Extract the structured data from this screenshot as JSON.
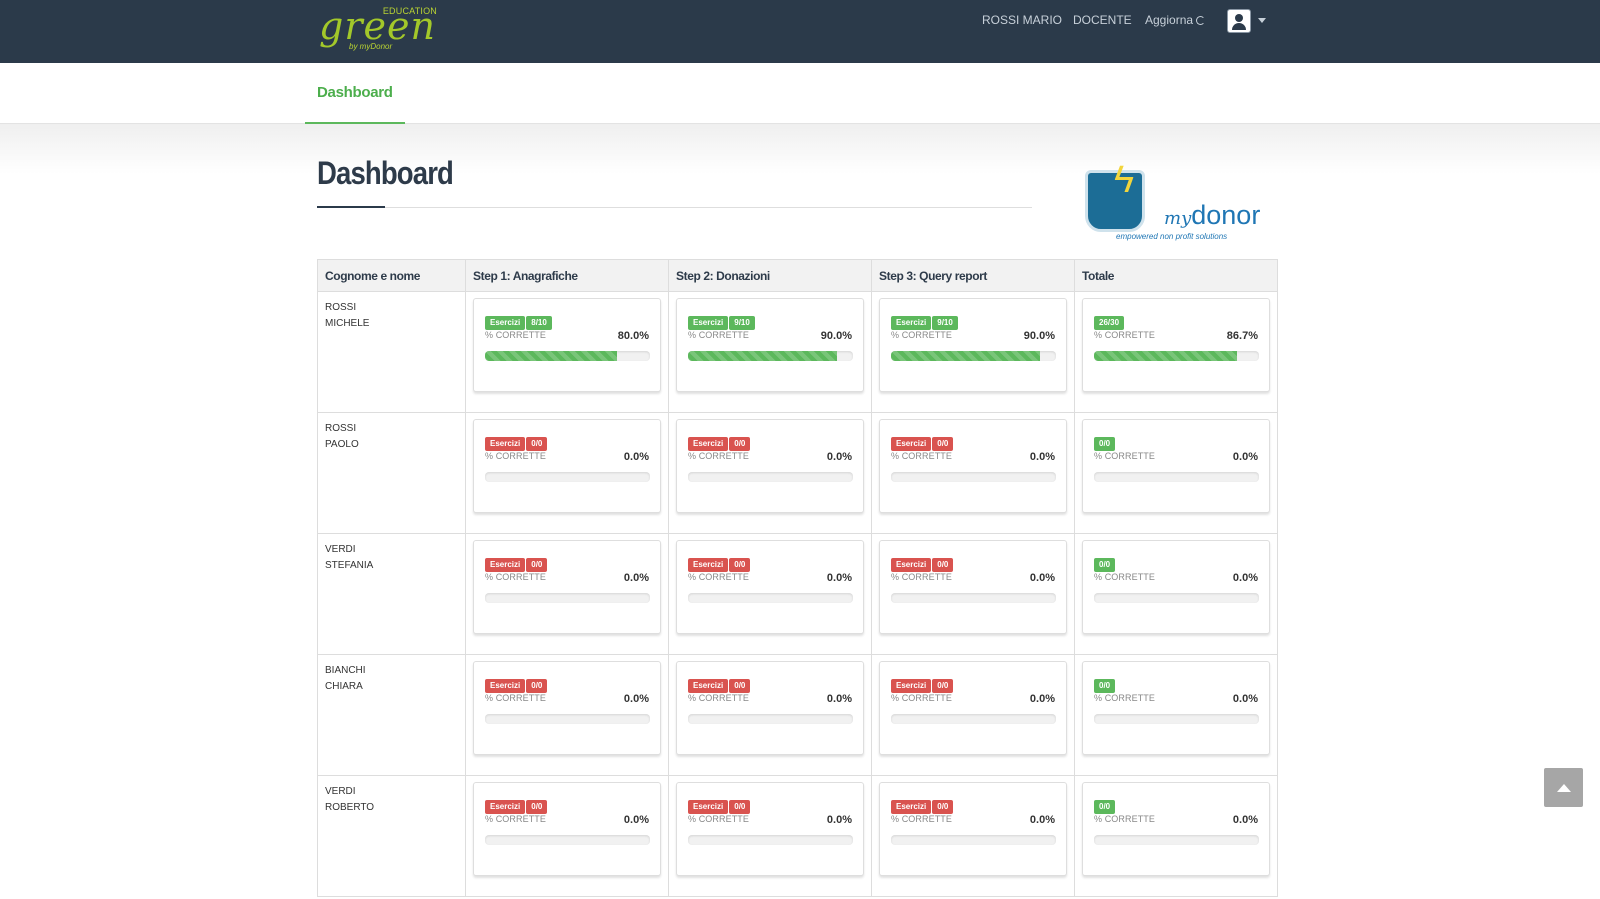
{
  "header": {
    "brand_top": "EDUCATION",
    "brand_main": "green",
    "brand_sub": "by myDonor",
    "user_name": "ROSSI MARIO",
    "role": "DOCENTE",
    "refresh_label": "Aggiorna"
  },
  "subnav": {
    "tab_label": "Dashboard"
  },
  "page": {
    "title": "Dashboard"
  },
  "partner_logo": {
    "prefix": "my",
    "name": "donor",
    "tagline": "empowered non profit solutions"
  },
  "table": {
    "columns": [
      "Cognome e nome",
      "Step 1: Anagrafiche",
      "Step 2: Donazioni",
      "Step 3: Query report",
      "Totale"
    ],
    "pct_label": "% CORRETTE",
    "exercise_label": "Esercizi",
    "rows": [
      {
        "surname": "ROSSI",
        "firstname": "MICHELE",
        "cells": [
          {
            "score": "8/10",
            "pct": "80.0%",
            "fill": 0.8,
            "status": "green"
          },
          {
            "score": "9/10",
            "pct": "90.0%",
            "fill": 0.9,
            "status": "green"
          },
          {
            "score": "9/10",
            "pct": "90.0%",
            "fill": 0.9,
            "status": "green"
          },
          {
            "score": "26/30",
            "pct": "86.7%",
            "fill": 0.867,
            "status": "green"
          }
        ]
      },
      {
        "surname": "ROSSI",
        "firstname": "PAOLO",
        "cells": [
          {
            "score": "0/0",
            "pct": "0.0%",
            "fill": 0,
            "status": "red"
          },
          {
            "score": "0/0",
            "pct": "0.0%",
            "fill": 0,
            "status": "red"
          },
          {
            "score": "0/0",
            "pct": "0.0%",
            "fill": 0,
            "status": "red"
          },
          {
            "score": "0/0",
            "pct": "0.0%",
            "fill": 0,
            "status": "green"
          }
        ]
      },
      {
        "surname": "VERDI",
        "firstname": "STEFANIA",
        "cells": [
          {
            "score": "0/0",
            "pct": "0.0%",
            "fill": 0,
            "status": "red"
          },
          {
            "score": "0/0",
            "pct": "0.0%",
            "fill": 0,
            "status": "red"
          },
          {
            "score": "0/0",
            "pct": "0.0%",
            "fill": 0,
            "status": "red"
          },
          {
            "score": "0/0",
            "pct": "0.0%",
            "fill": 0,
            "status": "green"
          }
        ]
      },
      {
        "surname": "BIANCHI",
        "firstname": "CHIARA",
        "cells": [
          {
            "score": "0/0",
            "pct": "0.0%",
            "fill": 0,
            "status": "red"
          },
          {
            "score": "0/0",
            "pct": "0.0%",
            "fill": 0,
            "status": "red"
          },
          {
            "score": "0/0",
            "pct": "0.0%",
            "fill": 0,
            "status": "red"
          },
          {
            "score": "0/0",
            "pct": "0.0%",
            "fill": 0,
            "status": "green"
          }
        ]
      },
      {
        "surname": "VERDI",
        "firstname": "ROBERTO",
        "cells": [
          {
            "score": "0/0",
            "pct": "0.0%",
            "fill": 0,
            "status": "red"
          },
          {
            "score": "0/0",
            "pct": "0.0%",
            "fill": 0,
            "status": "red"
          },
          {
            "score": "0/0",
            "pct": "0.0%",
            "fill": 0,
            "status": "red"
          },
          {
            "score": "0/0",
            "pct": "0.0%",
            "fill": 0,
            "status": "green"
          }
        ]
      }
    ]
  },
  "colors": {
    "navbar": "#2b3a4a",
    "accent_green": "#5cb85c",
    "danger_red": "#d9534f"
  },
  "icons": {
    "refresh": "refresh-icon",
    "user": "user-avatar-icon",
    "dropdown": "caret-down-icon",
    "back_to_top": "chevron-up-icon"
  }
}
